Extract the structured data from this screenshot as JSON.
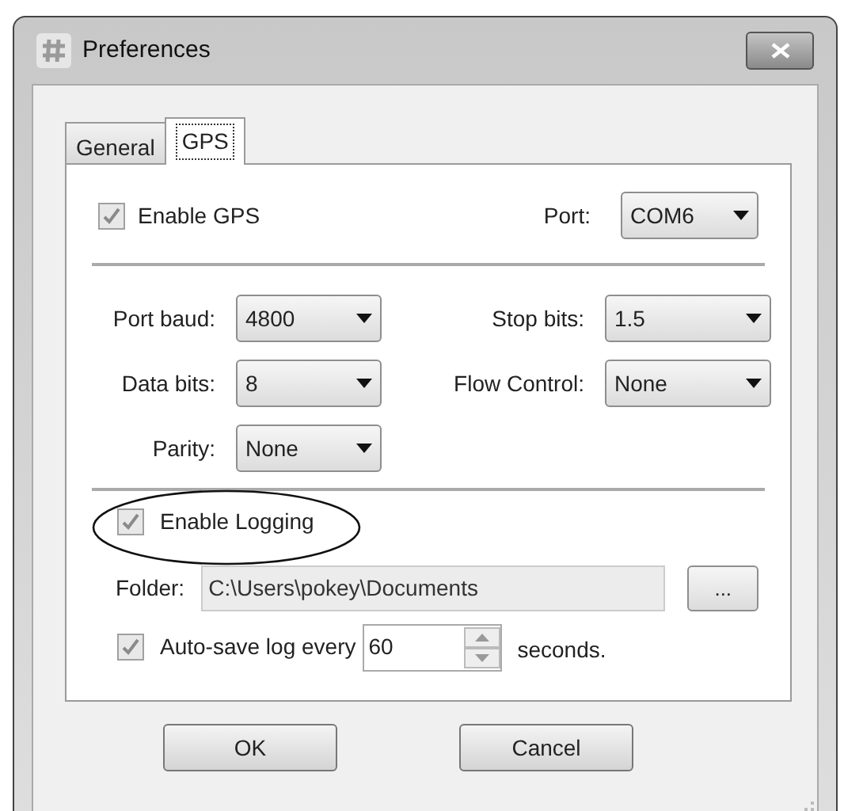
{
  "window": {
    "title": "Preferences"
  },
  "tabs": [
    {
      "label": "General",
      "selected": false
    },
    {
      "label": "GPS",
      "selected": true
    }
  ],
  "gps": {
    "enable": {
      "label": "Enable GPS",
      "checked": true
    },
    "port": {
      "label": "Port:",
      "value": "COM6"
    }
  },
  "serial": [
    {
      "label": "Port baud:",
      "value": "4800"
    },
    {
      "label": "Stop bits:",
      "value": "1.5"
    },
    {
      "label": "Data bits:",
      "value": "8"
    },
    {
      "label": "Flow Control:",
      "value": "None"
    },
    {
      "label": "Parity:",
      "value": "None"
    }
  ],
  "logging": {
    "enable": {
      "label": "Enable Logging",
      "checked": true,
      "circled": true
    },
    "folder": {
      "label": "Folder:",
      "value": "C:\\Users\\pokey\\Documents",
      "browse": "..."
    },
    "autosave": {
      "label": "Auto-save log every",
      "checked": true,
      "value": "60",
      "unit": "seconds."
    }
  },
  "buttons": [
    "OK",
    "Cancel"
  ]
}
